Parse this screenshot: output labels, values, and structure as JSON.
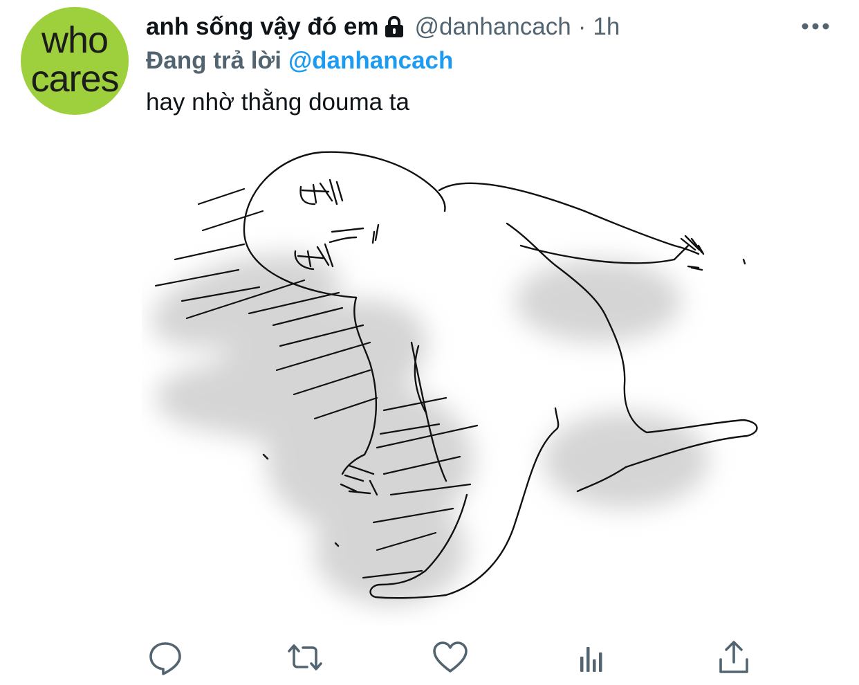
{
  "tweet": {
    "avatar": {
      "line1": "who",
      "line2": "cares",
      "color": "#9ecf3c"
    },
    "display_name": "anh sống vậy đó em",
    "lock_icon": "lock-icon",
    "handle": "@danhancach",
    "separator": "·",
    "time": "1h",
    "more_icon": "more-horizontal-icon",
    "reply_prefix": "Đang trả lời",
    "reply_handle": "@danhancach",
    "text": "hay nhờ thằng douma ta",
    "media": {
      "kind": "sketch-drawing"
    }
  },
  "actions": [
    {
      "icon": "reply-icon"
    },
    {
      "icon": "retweet-icon"
    },
    {
      "icon": "like-icon"
    },
    {
      "icon": "analytics-icon"
    },
    {
      "icon": "share-icon"
    }
  ],
  "colors": {
    "text": "#0f1419",
    "muted": "#536471",
    "accent": "#1d9bf0"
  }
}
